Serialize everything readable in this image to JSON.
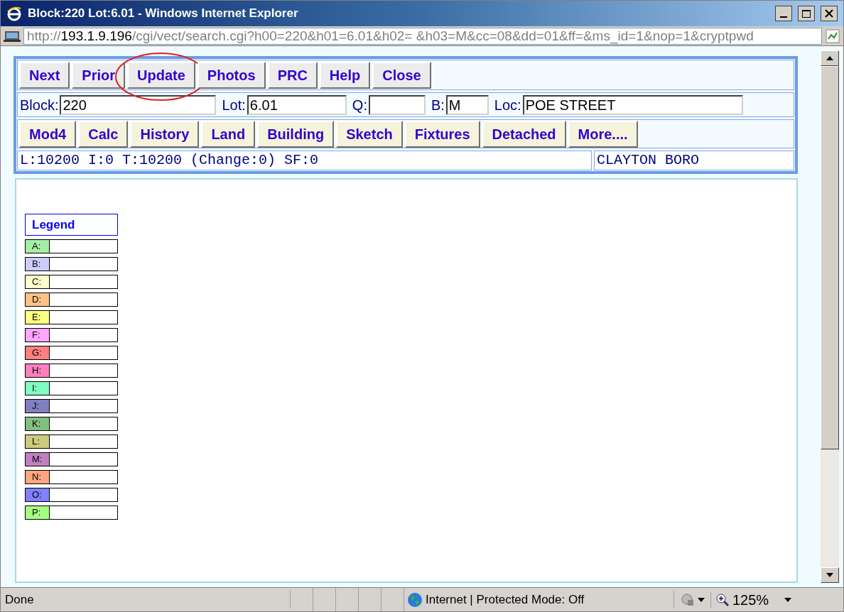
{
  "window": {
    "title": "Block:220 Lot:6.01 - Windows Internet Explorer"
  },
  "address": {
    "scheme": "http://",
    "host": "193.1.9.196",
    "path": "/cgi/vect/search.cgi?h00=220&h01=6.01&h02= &h03=M&cc=08&dd=01&ff=&ms_id=1&nop=1&cryptpwd"
  },
  "top_buttons": [
    {
      "label": "Next",
      "circled": false
    },
    {
      "label": "Prior",
      "circled": false
    },
    {
      "label": "Update",
      "circled": true
    },
    {
      "label": "Photos",
      "circled": false
    },
    {
      "label": "PRC",
      "circled": false
    },
    {
      "label": "Help",
      "circled": false
    },
    {
      "label": "Close",
      "circled": false
    }
  ],
  "fields": [
    {
      "label": "Block:",
      "value": "220"
    },
    {
      "label": "Lot:",
      "value": "6.01"
    },
    {
      "label": "Q:"
    },
    {
      "label": "B:",
      "value": "M"
    },
    {
      "label": "Loc:",
      "value": "POE STREET"
    }
  ],
  "module_buttons": [
    "Mod4",
    "Calc",
    "History",
    "Land",
    "Building",
    "Sketch",
    "Fixtures",
    "Detached",
    "More...."
  ],
  "summary": "L:10200 I:0 T:10200 (Change:0) SF:0",
  "municipality": "CLAYTON BORO",
  "legend": {
    "title": "Legend",
    "items": [
      {
        "label": "A:",
        "color": "#a6eea6"
      },
      {
        "label": "B:",
        "color": "#ccccff"
      },
      {
        "label": "C:",
        "color": "#ffffcc"
      },
      {
        "label": "D:",
        "color": "#ffc285"
      },
      {
        "label": "E:",
        "color": "#ffff80"
      },
      {
        "label": "F:",
        "color": "#ffa6ff"
      },
      {
        "label": "G:",
        "color": "#ff8080"
      },
      {
        "label": "H:",
        "color": "#ff80c0"
      },
      {
        "label": "I:",
        "color": "#80ffc0"
      },
      {
        "label": "J:",
        "color": "#8080c0"
      },
      {
        "label": "K:",
        "color": "#80c080"
      },
      {
        "label": "L:",
        "color": "#cccc80"
      },
      {
        "label": "M:",
        "color": "#c080c0"
      },
      {
        "label": "N:",
        "color": "#ffa680"
      },
      {
        "label": "O:",
        "color": "#8080ff"
      },
      {
        "label": "P:",
        "color": "#a6ff80"
      }
    ]
  },
  "status_bar": {
    "text": "Done",
    "zone": "Internet | Protected Mode: Off",
    "zoom": "125%"
  }
}
